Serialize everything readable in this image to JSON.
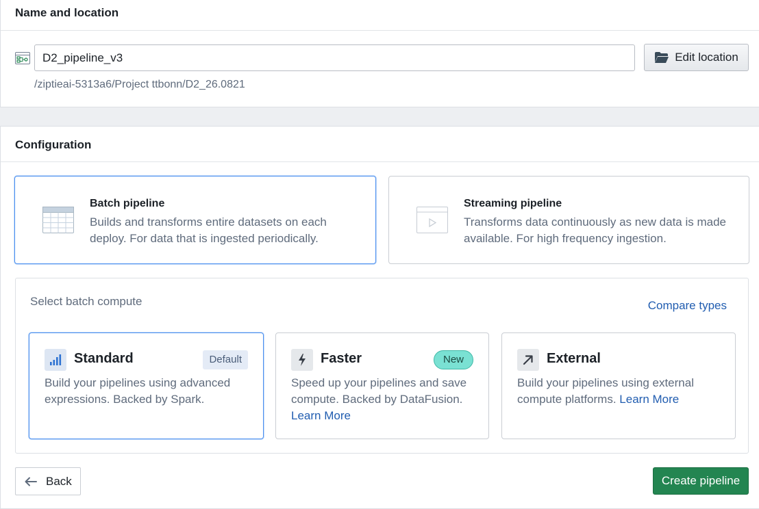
{
  "name_location": {
    "title": "Name and location",
    "pipeline_name": "D2_pipeline_v3",
    "edit_location_label": "Edit location",
    "path": "/ziptieai-5313a6/Project ttbonn/D2_26.0821"
  },
  "configuration": {
    "title": "Configuration",
    "pipeline_types": [
      {
        "title": "Batch pipeline",
        "description": "Builds and transforms entire datasets on each deploy. For data that is ingested periodically.",
        "selected": true
      },
      {
        "title": "Streaming pipeline",
        "description": "Transforms data continuously as new data is made available. For high frequency ingestion.",
        "selected": false
      }
    ],
    "compute": {
      "label": "Select batch compute",
      "compare_link": "Compare types",
      "options": [
        {
          "title": "Standard",
          "badge": "Default",
          "description": "Build your pipelines using advanced expressions. Backed by Spark.",
          "link": "",
          "selected": true
        },
        {
          "title": "Faster",
          "badge": "New",
          "description": "Speed up your pipelines and save compute. Backed by DataFusion.",
          "link": "Learn More",
          "selected": false
        },
        {
          "title": "External",
          "badge": "",
          "description": "Build your pipelines using external compute platforms.",
          "link": "Learn More",
          "selected": false
        }
      ]
    }
  },
  "footer": {
    "back_label": "Back",
    "create_label": "Create pipeline"
  },
  "colors": {
    "accent_blue": "#4c90f0",
    "link_blue": "#215db0",
    "create_green": "#238551",
    "new_badge": "#7ae1d3"
  }
}
